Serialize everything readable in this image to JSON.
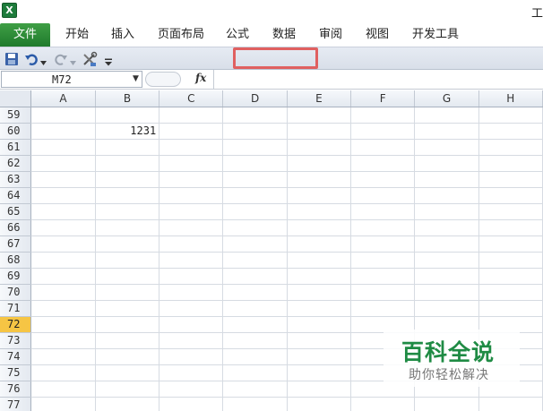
{
  "app": {
    "icon_letter": "X",
    "title_fragment": "工"
  },
  "ribbon": {
    "file_tab": "文件",
    "tabs": [
      "开始",
      "插入",
      "页面布局",
      "公式",
      "数据",
      "审阅",
      "视图",
      "开发工具"
    ]
  },
  "qat": {
    "icons": [
      "save-icon",
      "undo-icon",
      "undo-dropdown-icon",
      "redo-icon",
      "redo-dropdown-icon",
      "tools-icon",
      "customize-dropdown-icon"
    ]
  },
  "formula_bar": {
    "name_box": "M72",
    "fx_label": "fx",
    "formula": ""
  },
  "sheet": {
    "columns": [
      "A",
      "B",
      "C",
      "D",
      "E",
      "F",
      "G",
      "H"
    ],
    "rows": [
      "59",
      "60",
      "61",
      "62",
      "63",
      "64",
      "65",
      "66",
      "67",
      "68",
      "69",
      "70",
      "71",
      "72",
      "73",
      "74",
      "75",
      "76",
      "77"
    ],
    "active_row": "72",
    "cells": {
      "60": {
        "B": "1231"
      }
    }
  },
  "watermark": {
    "main": "百科全说",
    "sub": "助你轻松解决"
  },
  "colors": {
    "file_tab": "#2e8b3a",
    "highlight": "#e06060",
    "active_row": "#f6c544",
    "watermark": "#1f8b44"
  }
}
